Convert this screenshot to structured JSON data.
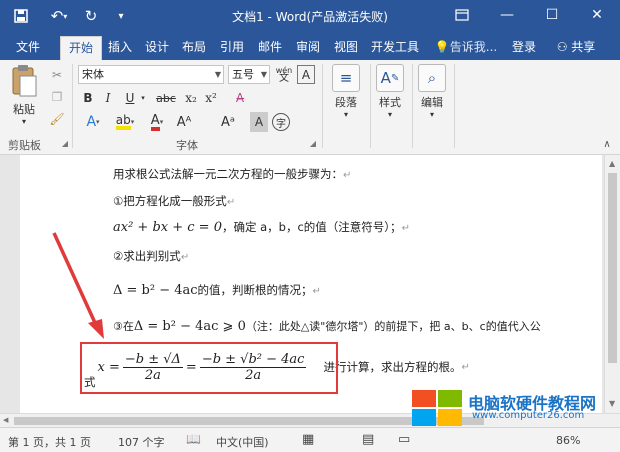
{
  "window": {
    "title": "文档1 - Word(产品激活失败)",
    "quick_access": [
      "save-icon",
      "undo-icon",
      "redo-icon",
      "customize-icon"
    ],
    "controls": [
      "ribbon-display-icon",
      "minimize-icon",
      "maximize-icon",
      "close-icon"
    ]
  },
  "tabs": {
    "file": "文件",
    "home": "开始",
    "insert": "插入",
    "design": "设计",
    "layout": "布局",
    "references": "引用",
    "mailings": "邮件",
    "review": "审阅",
    "view": "视图",
    "developer": "开发工具",
    "tell_me": "告诉我...",
    "login": "登录",
    "share": "共享"
  },
  "ribbon": {
    "clipboard": {
      "paste": "粘贴",
      "label": "剪贴板"
    },
    "font": {
      "font_name": "宋体",
      "font_size": "五号",
      "wen": "wén",
      "label": "字体",
      "bold": "B",
      "italic": "I",
      "underline": "U",
      "strike": "abc",
      "subscript": "x₂",
      "superscript": "x²"
    },
    "paragraph": {
      "label": "段落"
    },
    "styles": {
      "label": "样式"
    },
    "editing": {
      "label": "编辑"
    }
  },
  "document": {
    "line1": "用求根公式法解一元二次方程的一般步骤为：",
    "line2": "①把方程化成一般形式",
    "line3_math": "ax² + bx + c = 0",
    "line3_text": "，确定 a，b，c的值（注意符号）；",
    "line4": "②求出判别式",
    "line5_math": "Δ = b² − 4ac",
    "line5_text": "的值，判断根的情况；",
    "line6_prefix": "③在",
    "line6_math": "Δ = b² − 4ac ⩾ 0",
    "line6_text": "（注：此处△读\"德尔塔\"）的前提下，把 a、b、c的值代入公",
    "line7_prefix": "式",
    "formula_x": "x =",
    "formula_num1": "−b ± √Δ",
    "formula_den1": "2a",
    "formula_eq": "=",
    "formula_num2": "−b ± √b² − 4ac",
    "formula_den2": "2a",
    "line7_text": "进行计算，求出方程的根。",
    "para_mark": "↵"
  },
  "statusbar": {
    "page": "第 1 页，共 1 页",
    "words": "107 个字",
    "language": "中文(中国)",
    "zoom": "86%"
  },
  "watermark": {
    "title": "电脑软硬件教程网",
    "url": "www.computer26.com"
  },
  "colors": {
    "brand": "#2b579a",
    "annotation": "#e03a3a"
  }
}
